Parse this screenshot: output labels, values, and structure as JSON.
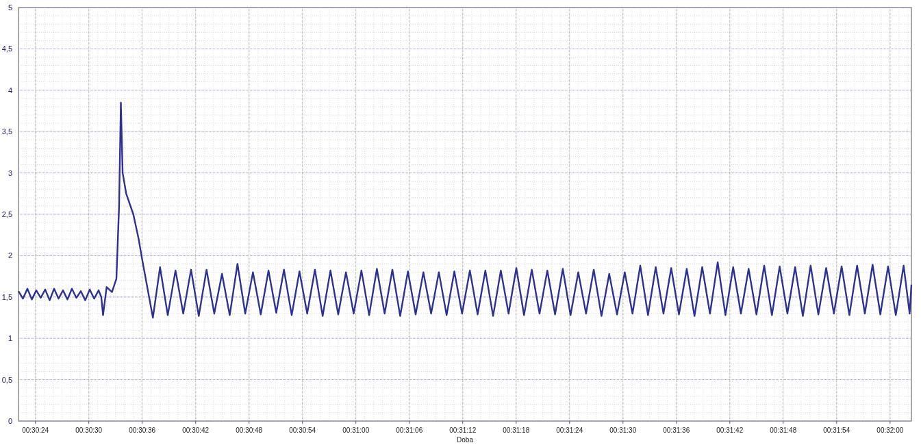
{
  "chart": {
    "chart_data": {
      "type": "line",
      "xlabel": "Doba",
      "grid": true,
      "xlim": [
        1822.1,
        1922.4
      ],
      "ylim": [
        0,
        5
      ],
      "xticks": [
        {
          "value": 1824,
          "label": "00:30:24"
        },
        {
          "value": 1830,
          "label": "00:30:30"
        },
        {
          "value": 1836,
          "label": "00:30:36"
        },
        {
          "value": 1842,
          "label": "00:30:42"
        },
        {
          "value": 1848,
          "label": "00:30:48"
        },
        {
          "value": 1854,
          "label": "00:30:54"
        },
        {
          "value": 1860,
          "label": "00:31:00"
        },
        {
          "value": 1866,
          "label": "00:31:06"
        },
        {
          "value": 1872,
          "label": "00:31:12"
        },
        {
          "value": 1878,
          "label": "00:31:18"
        },
        {
          "value": 1884,
          "label": "00:31:24"
        },
        {
          "value": 1890,
          "label": "00:31:30"
        },
        {
          "value": 1896,
          "label": "00:31:36"
        },
        {
          "value": 1902,
          "label": "00:31:42"
        },
        {
          "value": 1908,
          "label": "00:31:48"
        },
        {
          "value": 1914,
          "label": "00:31:54"
        },
        {
          "value": 1920,
          "label": "00:32:00"
        }
      ],
      "yticks": [
        {
          "value": 0,
          "label": "0"
        },
        {
          "value": 0.5,
          "label": "0,5"
        },
        {
          "value": 1,
          "label": "1"
        },
        {
          "value": 1.5,
          "label": "1,5"
        },
        {
          "value": 2,
          "label": "2"
        },
        {
          "value": 2.5,
          "label": "2,5"
        },
        {
          "value": 3,
          "label": "3"
        },
        {
          "value": 3.5,
          "label": "3,5"
        },
        {
          "value": 4,
          "label": "4"
        },
        {
          "value": 4.5,
          "label": "4,5"
        },
        {
          "value": 5,
          "label": "5"
        }
      ],
      "x": [
        1822.1,
        1822.6,
        1823.1,
        1823.6,
        1824.1,
        1824.6,
        1825.1,
        1825.6,
        1826.1,
        1826.6,
        1827.1,
        1827.6,
        1828.1,
        1828.6,
        1829.1,
        1829.6,
        1830.1,
        1830.6,
        1831.1,
        1831.4,
        1831.6,
        1832.0,
        1832.6,
        1833.1,
        1833.4,
        1833.6,
        1833.8,
        1834.2,
        1835.0,
        1835.6,
        1836.0,
        1837.2,
        1838.0,
        1838.87,
        1839.74,
        1840.61,
        1841.48,
        1842.35,
        1843.22,
        1844.09,
        1844.96,
        1845.83,
        1846.7,
        1847.57,
        1848.44,
        1849.31,
        1850.18,
        1851.05,
        1851.92,
        1852.79,
        1853.66,
        1854.53,
        1855.4,
        1856.27,
        1857.14,
        1858.01,
        1858.88,
        1859.75,
        1860.62,
        1861.49,
        1862.36,
        1863.23,
        1864.1,
        1864.97,
        1865.84,
        1866.71,
        1867.58,
        1868.45,
        1869.32,
        1870.19,
        1871.06,
        1871.93,
        1872.8,
        1873.67,
        1874.54,
        1875.41,
        1876.28,
        1877.15,
        1878.02,
        1878.89,
        1879.76,
        1880.63,
        1881.5,
        1882.37,
        1883.24,
        1884.11,
        1884.98,
        1885.85,
        1886.72,
        1887.59,
        1888.46,
        1889.33,
        1890.2,
        1891.07,
        1891.94,
        1892.81,
        1893.68,
        1894.55,
        1895.42,
        1896.29,
        1897.16,
        1898.03,
        1898.9,
        1899.77,
        1900.64,
        1901.51,
        1902.38,
        1903.25,
        1904.12,
        1904.99,
        1905.86,
        1906.73,
        1907.6,
        1908.47,
        1909.34,
        1910.21,
        1911.08,
        1911.95,
        1912.82,
        1913.69,
        1914.56,
        1915.43,
        1916.3,
        1917.17,
        1918.04,
        1918.91,
        1919.78,
        1920.65,
        1921.52,
        1922.2,
        1922.4
      ],
      "series": [
        {
          "color": "#2e3192",
          "values": [
            1.57,
            1.48,
            1.6,
            1.47,
            1.58,
            1.49,
            1.59,
            1.46,
            1.6,
            1.48,
            1.58,
            1.47,
            1.6,
            1.49,
            1.57,
            1.46,
            1.59,
            1.48,
            1.58,
            1.5,
            1.28,
            1.62,
            1.56,
            1.72,
            2.6,
            3.85,
            3.0,
            2.75,
            2.5,
            2.2,
            1.95,
            1.25,
            1.86,
            1.28,
            1.82,
            1.3,
            1.83,
            1.27,
            1.83,
            1.3,
            1.78,
            1.28,
            1.9,
            1.3,
            1.8,
            1.29,
            1.82,
            1.31,
            1.83,
            1.28,
            1.81,
            1.3,
            1.83,
            1.27,
            1.82,
            1.29,
            1.8,
            1.3,
            1.82,
            1.28,
            1.84,
            1.3,
            1.83,
            1.27,
            1.81,
            1.29,
            1.8,
            1.3,
            1.8,
            1.28,
            1.81,
            1.3,
            1.82,
            1.29,
            1.82,
            1.27,
            1.82,
            1.3,
            1.85,
            1.28,
            1.83,
            1.3,
            1.82,
            1.29,
            1.84,
            1.28,
            1.8,
            1.3,
            1.83,
            1.27,
            1.78,
            1.29,
            1.8,
            1.3,
            1.88,
            1.28,
            1.86,
            1.3,
            1.85,
            1.29,
            1.84,
            1.27,
            1.86,
            1.3,
            1.92,
            1.28,
            1.86,
            1.3,
            1.84,
            1.29,
            1.88,
            1.28,
            1.87,
            1.3,
            1.86,
            1.27,
            1.88,
            1.29,
            1.85,
            1.3,
            1.87,
            1.28,
            1.88,
            1.3,
            1.89,
            1.29,
            1.87,
            1.28,
            1.88,
            1.3,
            1.65
          ]
        }
      ]
    }
  }
}
